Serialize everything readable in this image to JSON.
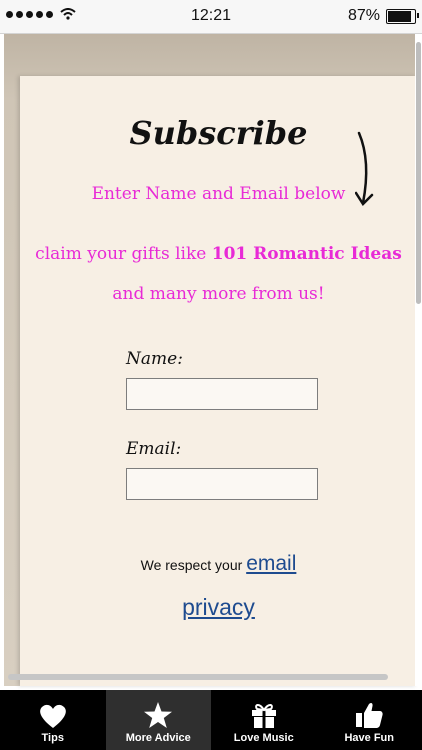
{
  "status": {
    "time": "12:21",
    "battery": "87%",
    "battery_level": 0.87
  },
  "page": {
    "title": "Subscribe",
    "line1": "Enter Name and Email below",
    "para_a": "claim your gifts like ",
    "para_bold": "101 Romantic Ideas",
    "para_b": " and many more from us!",
    "name_label": "Name:",
    "email_label": "Email:",
    "name_value": "",
    "email_value": "",
    "respect_text": "We respect your ",
    "email_link": "email",
    "privacy_link": "privacy"
  },
  "tabs": [
    {
      "label": "Tips",
      "icon": "heart-icon"
    },
    {
      "label": "More Advice",
      "icon": "star-icon"
    },
    {
      "label": "Love Music",
      "icon": "gift-icon"
    },
    {
      "label": "Have Fun",
      "icon": "thumbs-up-icon"
    }
  ],
  "colors": {
    "pink": "#e82ad6",
    "link": "#1e4b8f",
    "paper": "#f7efe4",
    "tabbar": "#000000"
  }
}
